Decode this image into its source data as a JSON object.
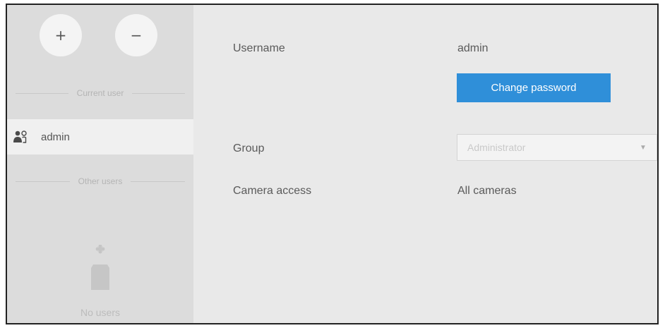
{
  "sidebar": {
    "add_label": "+",
    "remove_label": "−",
    "current_user_header": "Current user",
    "current_user_name": "admin",
    "other_users_header": "Other users",
    "empty_text": "No users"
  },
  "details": {
    "username_label": "Username",
    "username_value": "admin",
    "change_password_label": "Change password",
    "group_label": "Group",
    "group_value": "Administrator",
    "camera_access_label": "Camera access",
    "camera_access_value": "All cameras"
  },
  "colors": {
    "accent": "#2f8fd9",
    "sidebar_bg": "#dcdcdc",
    "content_bg": "#e9e9e9",
    "selected_row_bg": "#f0f0f0"
  }
}
